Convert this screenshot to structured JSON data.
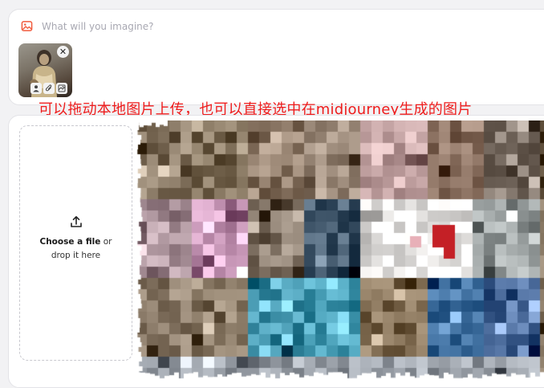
{
  "prompt": {
    "placeholder": "What will you imagine?",
    "value": "",
    "image_icon": "image-icon",
    "close_label": "✕"
  },
  "annotation": {
    "text": "可以拖动本地图片上传，也可以直接选中在midjourney生成的图片"
  },
  "dropzone": {
    "icon": "upload-icon",
    "line1_strong": "Choose a file",
    "line1_rest": " or",
    "line2": "drop it here"
  },
  "colors": {
    "accent": "#f05a3c",
    "annotation": "#ee1c1c",
    "panel_bg": "#ffffff",
    "page_bg": "#f2f2f4",
    "border": "#e3e3e7",
    "placeholder": "#a8a8b2"
  },
  "gallery": {
    "pixelated": true,
    "tiles": [
      {
        "tone": "#8a7a66"
      },
      {
        "tone": "#7e6e58"
      },
      {
        "tone": "#8e7a68"
      },
      {
        "tone": "#9a8878"
      },
      {
        "tone": "#c8a8a8"
      },
      {
        "tone": "#8a7060"
      },
      {
        "tone": "#b098a0"
      },
      {
        "tone": "#d0a0c0"
      },
      {
        "tone": "#8c7e70"
      },
      {
        "tone": "#3e5468"
      },
      {
        "tone": "#f2f0ee"
      },
      {
        "tone": "#9ea4a4"
      },
      {
        "tone": "#8a7a68"
      },
      {
        "tone": "#948470"
      },
      {
        "tone": "#3e90a8"
      },
      {
        "tone": "#4aa0b8"
      },
      {
        "tone": "#7e6a50"
      },
      {
        "tone": "#4070a0"
      },
      {
        "tone": "#5070a0"
      }
    ]
  }
}
